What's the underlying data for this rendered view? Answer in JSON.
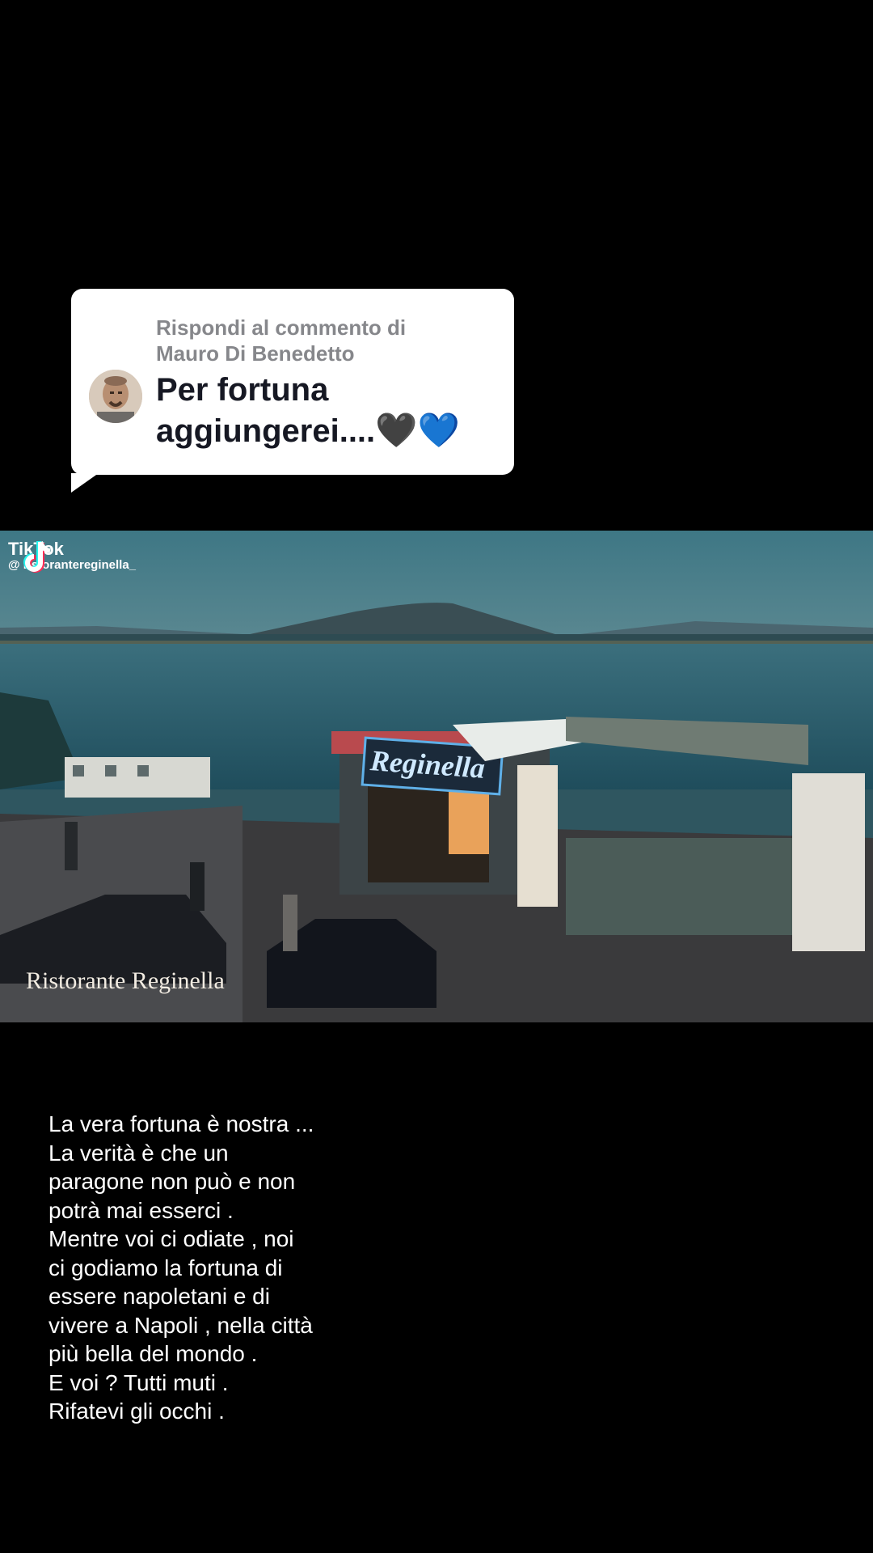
{
  "reply": {
    "header_line1": "Rispondi al commento di",
    "header_line2": "Mauro Di Benedetto",
    "comment_line1": "Per fortuna",
    "comment_line2": "aggiungerei....",
    "heart_black": "🖤",
    "heart_blue": "💙"
  },
  "video": {
    "watermark_brand": "TikTok",
    "watermark_handle": "@ ristorantereginella_",
    "sign_text": "Reginella",
    "caption": "Ristorante Reginella"
  },
  "overlay_lines": [
    "La vera fortuna è nostra ...",
    "La verità è che un",
    "paragone non può e non",
    "potrà mai esserci .",
    "Mentre voi ci odiate , noi",
    "ci godiamo la fortuna di",
    "essere napoletani e di",
    "vivere a Napoli , nella città",
    "più bella del mondo .",
    "E voi ? Tutti muti .",
    "Rifatevi gli occhi ."
  ],
  "colors": {
    "background": "#000000",
    "card": "#ffffff",
    "header_gray": "#86878b",
    "comment_text": "#161823",
    "overlay_text": "#ffffff"
  }
}
